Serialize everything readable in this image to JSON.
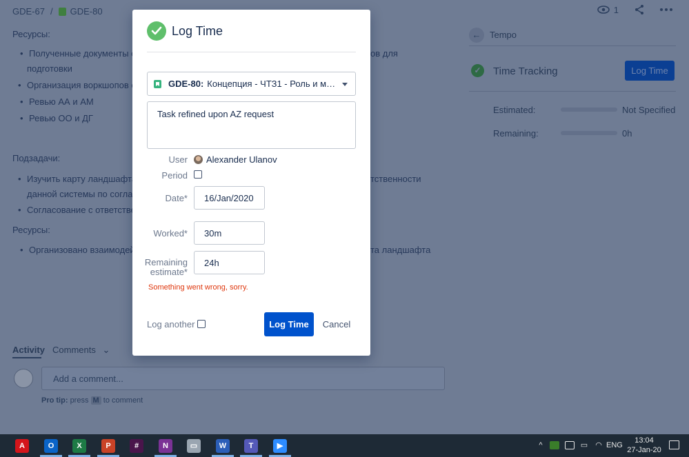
{
  "breadcrumb": {
    "parent": "GDE-67",
    "separator": "/",
    "current": "GDE-80"
  },
  "header_actions": {
    "watchers_count": "1"
  },
  "background": {
    "resources_heading_1": "Ресурсы:",
    "resources_items_1": [
      "Полученные документы об",
      "подготовки",
      "Организация воркшопов с",
      "Ревью АА и АМ",
      "Ревью ОО и ДГ"
    ],
    "resources_tail_1": "ов для",
    "subtasks_heading": "Подзадачи:",
    "subtasks_items": [
      "Изучить карту ландшафта/и",
      "данной системы по согласо",
      "Согласование с ответственн"
    ],
    "subtasks_tail": "тственности",
    "resources_heading_2": "Ресурсы:",
    "resources_items_2": [
      "Организовано взаимодейс"
    ],
    "resources_tail_2": "та ландшафта",
    "activity_label": "Activity",
    "comments_tab": "Comments",
    "comment_placeholder": "Add a comment...",
    "protip_prefix": "Pro tip:",
    "protip_press": "press",
    "protip_key": "M",
    "protip_suffix": "to comment"
  },
  "tempo_panel": {
    "back_title": "Tempo",
    "time_tracking_title": "Time Tracking",
    "log_time_button": "Log Time",
    "estimated_label": "Estimated:",
    "estimated_value": "Not Specified",
    "remaining_label": "Remaining:",
    "remaining_value": "0h"
  },
  "modal": {
    "title": "Log Time",
    "issue_key": "GDE-80:",
    "issue_summary": "Концепция - ЧТЗ1 - Роль и мест…",
    "description": "Task refined upon AZ request",
    "user_label": "User",
    "user_value": "Alexander Ulanov",
    "period_label": "Period",
    "date_label": "Date*",
    "date_value": "16/Jan/2020",
    "worked_label": "Worked*",
    "worked_value": "30m",
    "remaining_label_1": "Remaining",
    "remaining_label_2": "estimate*",
    "remaining_value": "24h",
    "error": "Something went wrong, sorry.",
    "log_another_label": "Log another",
    "log_time_button": "Log Time",
    "cancel_button": "Cancel"
  },
  "taskbar": {
    "apps": [
      {
        "name": "acrobat-icon",
        "glyph": "A",
        "color": "#d4151b"
      },
      {
        "name": "outlook-icon",
        "glyph": "O",
        "color": "#0a64c8"
      },
      {
        "name": "excel-icon",
        "glyph": "X",
        "color": "#1d7a45"
      },
      {
        "name": "powerpoint-icon",
        "glyph": "P",
        "color": "#c94327"
      },
      {
        "name": "slack-icon",
        "glyph": "#",
        "color": "#4a154b"
      },
      {
        "name": "onenote-icon",
        "glyph": "N",
        "color": "#7b3295"
      },
      {
        "name": "file-explorer-icon",
        "glyph": "▭",
        "color": "#9aa5b1"
      },
      {
        "name": "word-icon",
        "glyph": "W",
        "color": "#2b5eb8"
      },
      {
        "name": "teams-icon",
        "glyph": "T",
        "color": "#5459b8"
      },
      {
        "name": "zoom-icon",
        "glyph": "▶",
        "color": "#2d8cff"
      }
    ],
    "language": "ENG",
    "time": "13:04",
    "date": "27-Jan-20"
  },
  "colors": {
    "primary": "#0052cc",
    "success": "#36b37e",
    "error": "#de350b",
    "overlay": "#6f7c94"
  }
}
